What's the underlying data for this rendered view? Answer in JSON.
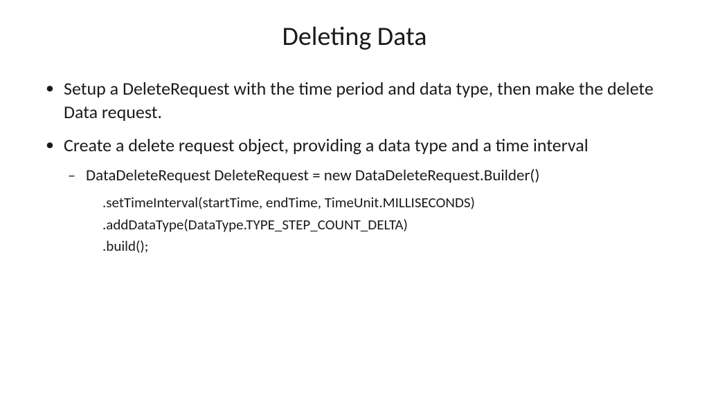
{
  "slide": {
    "title": "Deleting Data",
    "bullets": [
      {
        "text": "Setup a DeleteRequest with the time period and data type, then make the delete Data request."
      },
      {
        "text": "Create a delete request object, providing a data type and a time interval",
        "sub": {
          "text": "DataDeleteRequest DeleteRequest = new DataDeleteRequest.Builder()",
          "code": [
            ".setTimeInterval(startTime, endTime, TimeUnit.MILLISECONDS)",
            ".addDataType(DataType.TYPE_STEP_COUNT_DELTA)",
            ".build();"
          ]
        }
      }
    ]
  }
}
